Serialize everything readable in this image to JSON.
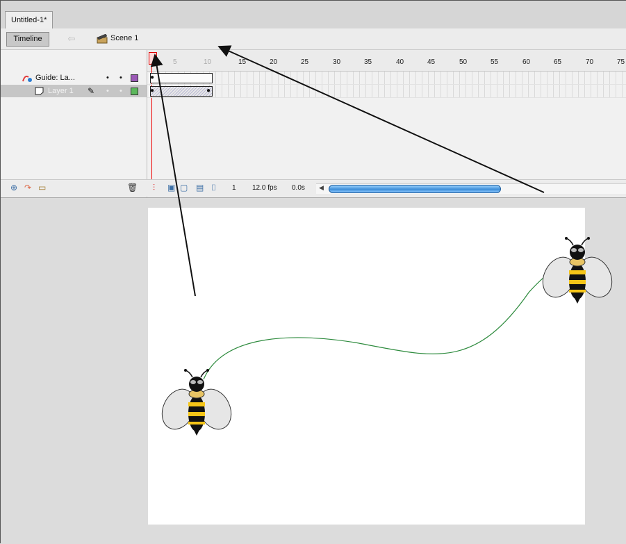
{
  "document_tab": "Untitled-1*",
  "scene_bar": {
    "timeline_button": "Timeline",
    "scene_label": "Scene 1"
  },
  "timeline": {
    "frame_numbers": [
      "5",
      "10",
      "15",
      "20",
      "25",
      "30",
      "35",
      "40",
      "45",
      "50",
      "55",
      "60",
      "65",
      "70",
      "75"
    ],
    "layers": [
      {
        "name": "Guide: La...",
        "color": "#9b59b6"
      },
      {
        "name": "Layer 1",
        "color": "#5cb85c"
      }
    ],
    "status": {
      "current_frame": "1",
      "frame_rate": "12.0 fps",
      "elapsed": "0.0s"
    }
  },
  "colors": {
    "guide_path": "#2e8b3e",
    "playhead": "#e00000",
    "scroll_thumb": "#3d8ed8",
    "bee_stripe": "#f5c518"
  },
  "icons": [
    "eye-icon",
    "lock-icon",
    "outline-icon",
    "guide-layer-icon",
    "layer-icon",
    "pencil-icon",
    "add-layer-icon",
    "add-motion-guide-icon",
    "add-folder-icon",
    "trash-icon",
    "onion-skin-icon",
    "edit-multiple-frames-icon",
    "scene-icon",
    "back-arrow-icon"
  ]
}
